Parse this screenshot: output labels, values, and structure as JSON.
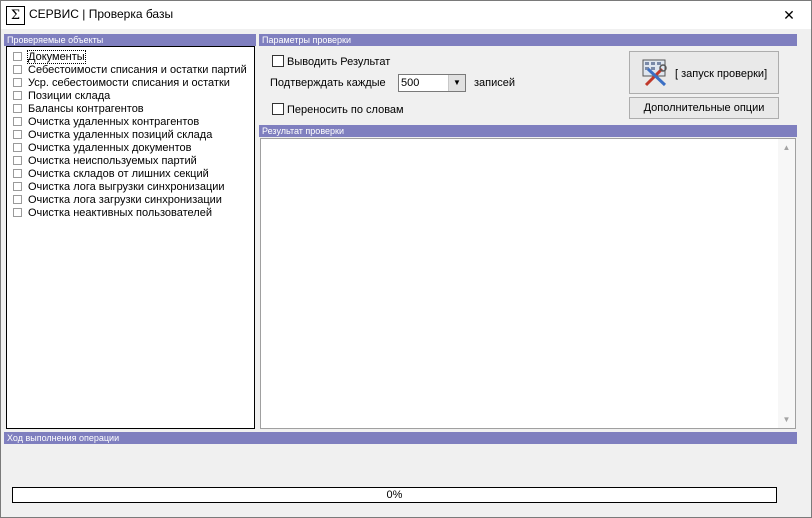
{
  "window": {
    "title": "СЕРВИС | Проверка базы",
    "app_icon": "Σ",
    "close_label": "✕"
  },
  "objects_panel": {
    "header": "Проверяемые объекты",
    "items": [
      "Документы",
      "Себестоимости списания и остатки партий",
      "Уср. себестоимости списания и остатки",
      "Позиции склада",
      "Балансы контрагентов",
      "Очистка удаленных контрагентов",
      "Очистка удаленных позиций склада",
      "Очистка удаленных документов",
      "Очистка неиспользуемых партий",
      "Очистка складов от лишних секций",
      "Очистка лога выгрузки синхронизации",
      "Очистка лога загрузки синхронизации",
      "Очистка  неактивных пользователей"
    ]
  },
  "params": {
    "header": "Параметры проверки",
    "output_result_label": "Выводить Результат",
    "confirm_every_label": "Подтверждать каждые",
    "confirm_every_value": "500",
    "records_label": "записей",
    "word_wrap_label": "Переносить по словам",
    "run_button_label": "[ запуск проверки]",
    "options_button_label": "Дополнительные опции"
  },
  "result": {
    "header": "Результат проверки"
  },
  "progress": {
    "header": "Ход выполнения операции",
    "value": 0,
    "text": "0%"
  },
  "colors": {
    "section_header": "#7f7fbf",
    "window_bg": "#f0f0f0"
  }
}
